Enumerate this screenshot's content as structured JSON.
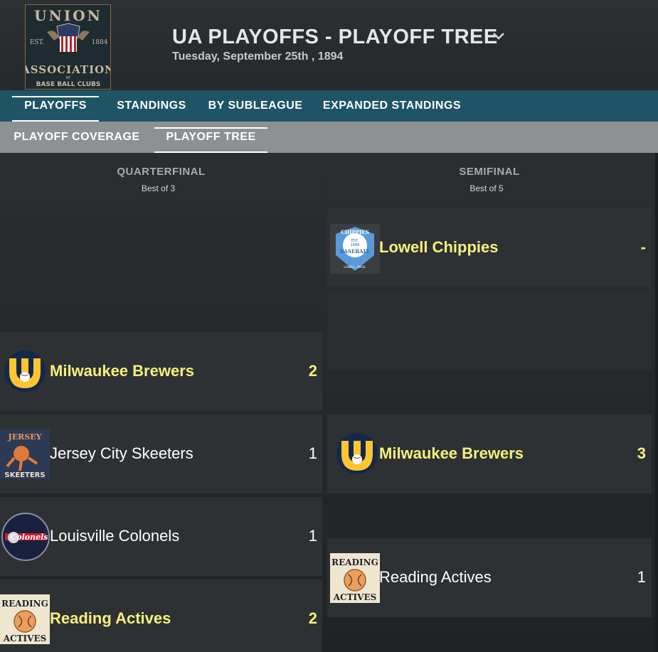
{
  "app": {
    "logo_text_top": "UNION",
    "logo_est": "EST.",
    "logo_year": "1884",
    "logo_text_mid": "ASSOCIATION",
    "logo_by": "BY",
    "logo_text_bottom": "BASE BALL CLUBS",
    "title": "UA PLAYOFFS - PLAYOFF TREE",
    "subtitle": "Tuesday, September 25th , 1894"
  },
  "nav_primary": [
    {
      "label": "PLAYOFFS",
      "active": true
    },
    {
      "label": "STANDINGS",
      "active": false
    },
    {
      "label": "BY SUBLEAGUE",
      "active": false
    },
    {
      "label": "EXPANDED STANDINGS",
      "active": false
    }
  ],
  "nav_secondary": [
    {
      "label": "PLAYOFF COVERAGE",
      "active": false
    },
    {
      "label": "PLAYOFF TREE",
      "active": true
    }
  ],
  "rounds": [
    {
      "name": "QUARTERFINAL",
      "series_length": "Best of 3",
      "matchups": [
        {
          "teams": [
            {
              "name": "Milwaukee Brewers",
              "score": "2",
              "winner": true,
              "logo": "brewers-logo"
            },
            {
              "name": "Jersey City Skeeters",
              "score": "1",
              "winner": false,
              "logo": "skeeters-logo"
            }
          ]
        },
        {
          "teams": [
            {
              "name": "Louisville Colonels",
              "score": "1",
              "winner": false,
              "logo": "colonels-logo"
            },
            {
              "name": "Reading Actives",
              "score": "2",
              "winner": true,
              "logo": "actives-logo"
            }
          ]
        }
      ]
    },
    {
      "name": "SEMIFINAL",
      "series_length": "Best of 5",
      "matchups": [
        {
          "teams": [
            {
              "name": "Lowell Chippies",
              "score": "-",
              "winner": true,
              "logo": "chippies-logo"
            }
          ]
        },
        {
          "teams": [
            {
              "name": "Milwaukee Brewers",
              "score": "3",
              "winner": true,
              "logo": "brewers-logo"
            },
            {
              "name": "Reading Actives",
              "score": "1",
              "winner": false,
              "logo": "actives-logo"
            }
          ]
        }
      ]
    }
  ],
  "logo_texts": {
    "skeeters_top": "JERSEY",
    "skeeters_bottom": "SKEETERS",
    "colonels": "Colonels",
    "actives_top": "READING",
    "actives_bottom": "ACTIVES",
    "chippies_top": "CHIPPIES",
    "chippies_est": "EST.",
    "chippies_year": "1888",
    "chippies_mid": "BASEBALL",
    "chippies_bottom": "LOWELL, MASS."
  },
  "colors": {
    "winner_text": "#f7f07a",
    "nav_primary_bg": "#1f5467",
    "nav_secondary_bg": "#8e9194",
    "brewers_navy": "#13294b",
    "brewers_gold": "#ffc52f"
  }
}
